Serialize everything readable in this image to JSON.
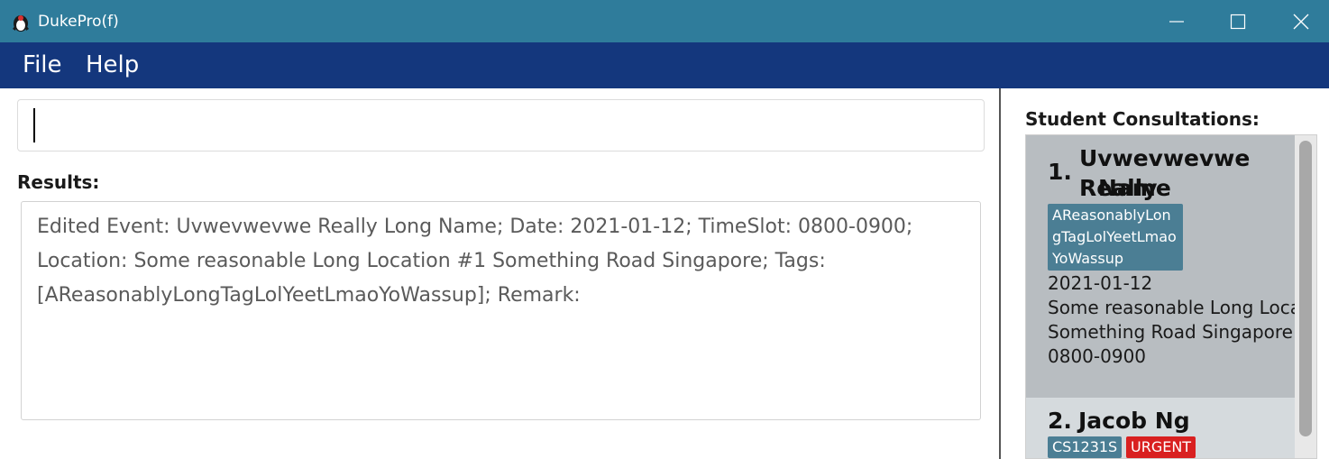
{
  "window": {
    "title": "DukePro(f)",
    "icon": "duke-penguin-icon"
  },
  "window_controls": {
    "minimize_icon": "minimize-icon",
    "maximize_icon": "maximize-icon",
    "close_icon": "close-icon"
  },
  "menu": {
    "items": [
      {
        "label": "File"
      },
      {
        "label": "Help"
      }
    ]
  },
  "command": {
    "value": ""
  },
  "results": {
    "label": "Results:",
    "text": "Edited Event: Uvwevwevwe Really Long Name; Date: 2021-01-12; TimeSlot: 0800-0900; Location: Some reasonable Long Location #1 Something Road Singapore; Tags: [AReasonablyLongTagLolYeetLmaoYoWassup]; Remark:"
  },
  "consultations": {
    "title": "Student Consultations:",
    "items": [
      {
        "index": "1.",
        "name_line1": "Uvwevwevwe Really",
        "name_line2": "Name",
        "tag_line1": "AReasonablyLon",
        "tag_line2": "gTagLolYeetLmao",
        "tag_line3": "YoWassup",
        "date": "2021-01-12",
        "location_line1": "Some reasonable Long Locatio",
        "location_line2": "Something Road Singapore",
        "time": "0800-0900"
      },
      {
        "index": "2.",
        "name": "Jacob Ng",
        "tags": [
          "CS1231S",
          "URGENT"
        ]
      }
    ]
  },
  "colors": {
    "titlebar": "#2f7c9b",
    "menubar": "#14377d",
    "tag": "#4b7e94",
    "urgent_tag": "#d92020",
    "selected_card": "#b8bdc1"
  }
}
